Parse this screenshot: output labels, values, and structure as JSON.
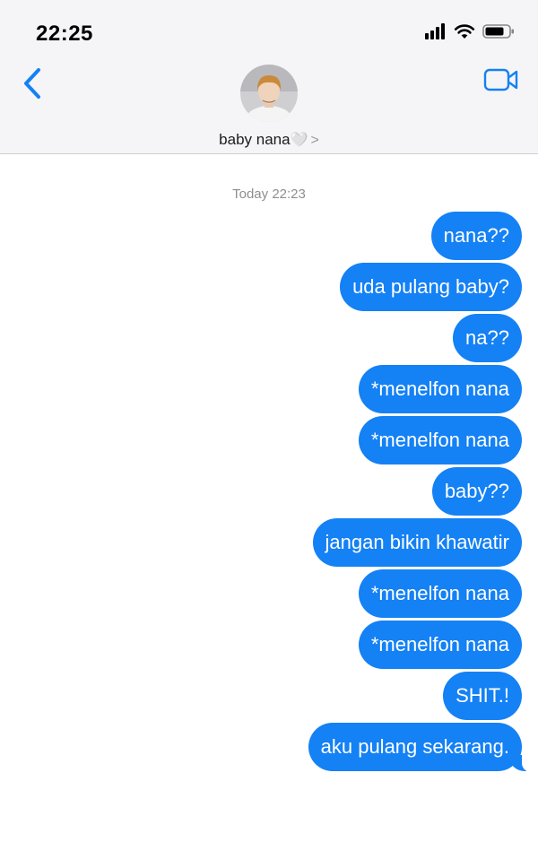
{
  "status_bar": {
    "time": "22:25"
  },
  "header": {
    "contact_name": "baby nana",
    "heart_glyph": "🤍",
    "chevron_glyph": ">"
  },
  "conversation": {
    "timestamp": "Today 22:23",
    "messages": [
      "nana??",
      "uda pulang baby?",
      "na??",
      "*menelfon nana",
      "*menelfon nana",
      "baby??",
      "jangan bikin khawatir",
      "*menelfon nana",
      "*menelfon nana",
      "SHIT.!",
      "aku pulang sekarang."
    ]
  },
  "colors": {
    "bubble": "#1481f5",
    "accent": "#1481f5",
    "header_bg": "#f5f5f7"
  },
  "icons": [
    "signal-icon",
    "wifi-icon",
    "battery-icon",
    "back-chevron-icon",
    "video-call-icon"
  ]
}
